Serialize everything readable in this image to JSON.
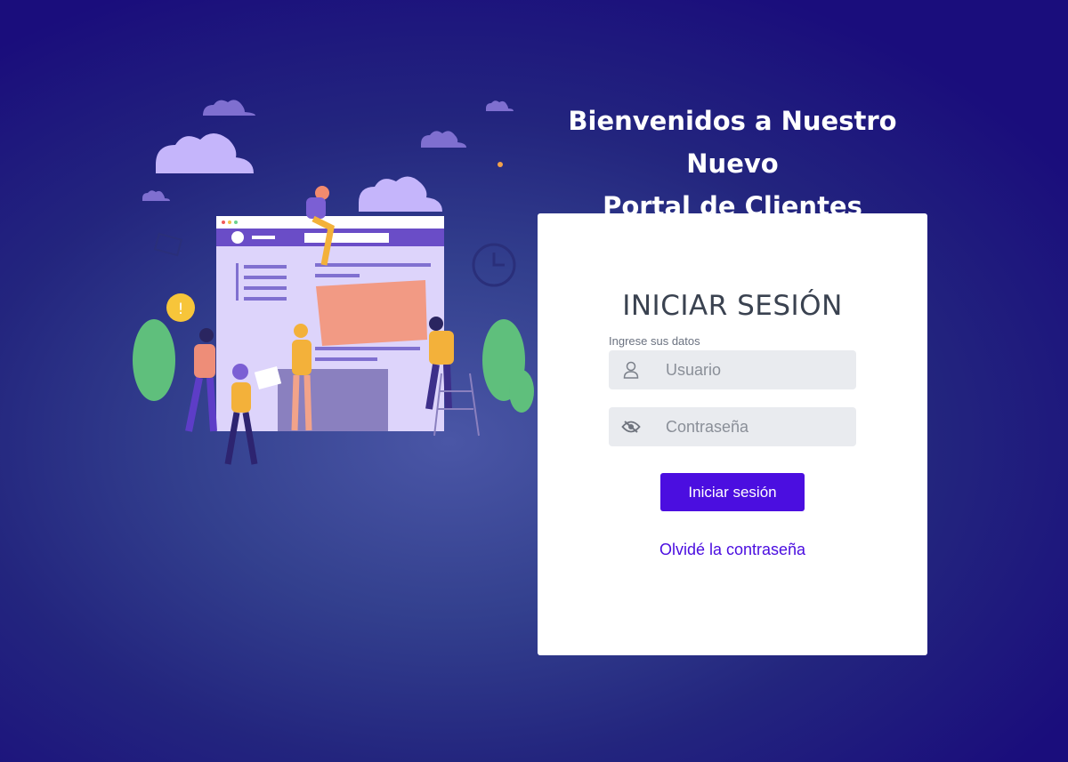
{
  "welcome": {
    "line1": "Bienvenidos a Nuestro Nuevo",
    "line2": "Portal de Clientes"
  },
  "login": {
    "title": "INICIAR SESIÓN",
    "subtitle": "Ingrese sus datos",
    "username": {
      "placeholder": "Usuario",
      "value": "",
      "icon": "user-icon"
    },
    "password": {
      "placeholder": "Contraseña",
      "value": "",
      "icon": "eye-slash-icon"
    },
    "submit_label": "Iniciar sesión",
    "forgot_label": "Olvidé la contraseña"
  },
  "colors": {
    "accent": "#4b0ee0",
    "background": "#23257e",
    "card": "#ffffff"
  }
}
